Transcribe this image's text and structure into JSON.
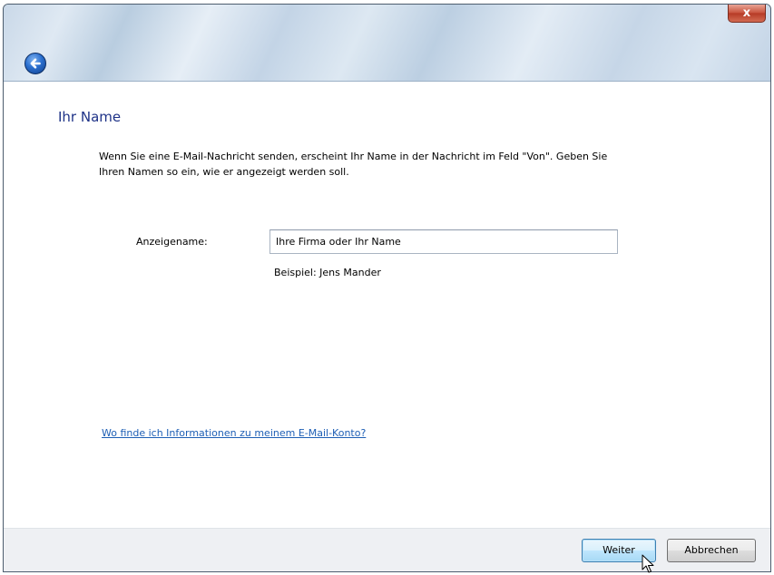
{
  "window": {
    "close_label": "x",
    "back_icon": "back-arrow-icon"
  },
  "main": {
    "heading": "Ihr Name",
    "description": "Wenn Sie eine E-Mail-Nachricht senden, erscheint Ihr Name in der Nachricht im Feld \"Von\". Geben Sie Ihren Namen so ein, wie er angezeigt werden soll.",
    "display_name_label": "Anzeigename:",
    "display_name_value": "Ihre Firma oder Ihr Name",
    "example_text": "Beispiel: Jens Mander",
    "help_link": "Wo finde ich Informationen zu meinem E-Mail-Konto?"
  },
  "footer": {
    "next_label": "Weiter",
    "cancel_label": "Abbrechen"
  },
  "colors": {
    "heading": "#1e3287",
    "link": "#1e5fb5",
    "close_button": "#c7503a",
    "default_button_border": "#3c7fb1"
  }
}
